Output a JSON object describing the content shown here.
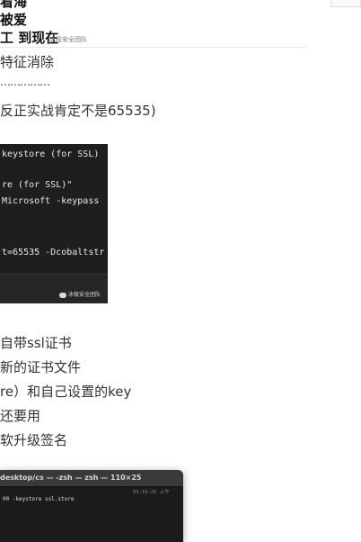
{
  "header": {
    "line1": "看海",
    "line2": "被爱",
    "line3": "工 到现在",
    "watermark": "冰极安全团队"
  },
  "body": {
    "para1": "特征消除",
    "dots": "……………",
    "para2": "反正实战肯定不是65535)",
    "para3": "自带ssl证书",
    "para4": "新的证书文件",
    "para5": "re）和自己设置的key",
    "para6": "还要用",
    "para7": "软升级签名"
  },
  "code_image": {
    "line1": " keystore (for SSL)",
    "line2": "re (for SSL)\"",
    "line3": "Microsoft -keypass",
    "line4": "t=65535 -Dcobaltstr",
    "watermark": "冰极安全团队"
  },
  "terminal": {
    "title": "desktop/cs — -zsh — zsh — 110×25",
    "time": "03:16:25 上午",
    "command": "00 -keystore ssl.store"
  }
}
